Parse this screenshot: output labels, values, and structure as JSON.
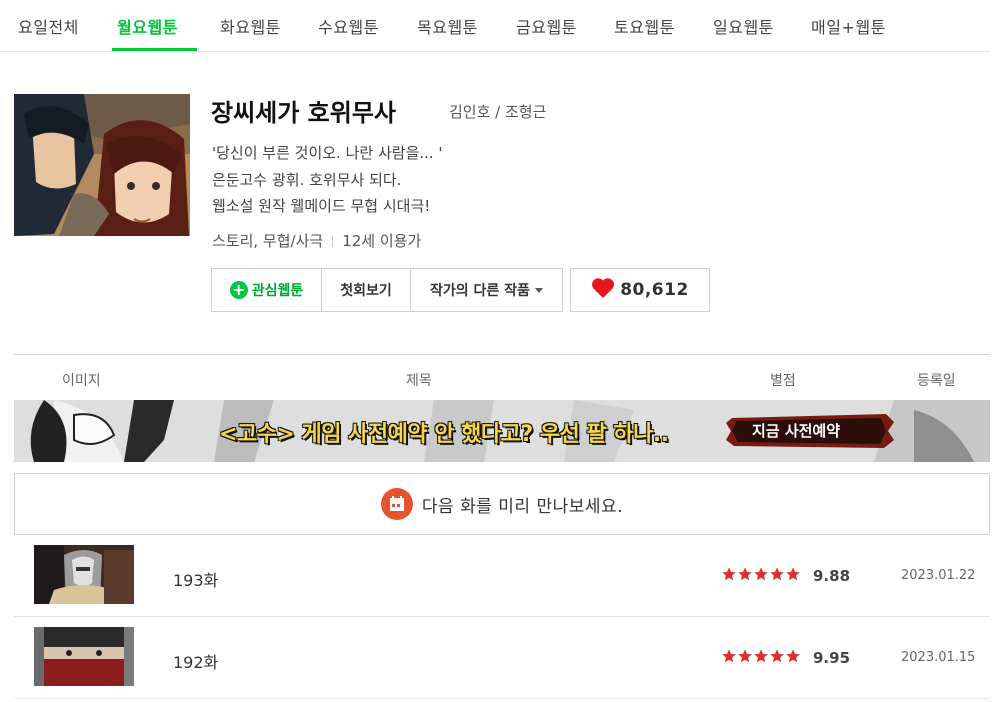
{
  "tabs": [
    {
      "label": "요일전체",
      "active": false
    },
    {
      "label": "월요웹툰",
      "active": true
    },
    {
      "label": "화요웹툰",
      "active": false
    },
    {
      "label": "수요웹툰",
      "active": false
    },
    {
      "label": "목요웹툰",
      "active": false
    },
    {
      "label": "금요웹툰",
      "active": false
    },
    {
      "label": "토요웹툰",
      "active": false
    },
    {
      "label": "일요웹툰",
      "active": false
    },
    {
      "label": "매일+웹툰",
      "active": false
    }
  ],
  "webtoon": {
    "title": "장씨세가 호위무사",
    "author": "김인호 / 조형근",
    "desc1": "'당신이 부른 것이오. 나란 사람을... '",
    "desc2": "은둔고수 광휘. 호위무사 되다.",
    "desc3": "웹소설 원작 웰메이드 무협 시대극!",
    "genre": "스토리, 무협/사극",
    "age": "12세 이용가"
  },
  "buttons": {
    "favorite": "관심웹툰",
    "first_episode": "첫회보기",
    "other_works": "작가의 다른 작품",
    "like_count": "80,612"
  },
  "table_header": {
    "image": "이미지",
    "title": "제목",
    "rating": "별점",
    "date": "등록일"
  },
  "banner": {
    "text": "<고수> 게임 사전예약 안 했다고? 우선 팔 하나..",
    "cta": "지금 사전예약"
  },
  "preview": {
    "text": "다음 화를 미리 만나보세요."
  },
  "episodes": [
    {
      "title": "193화",
      "rating": "9.88",
      "date": "2023.01.22"
    },
    {
      "title": "192화",
      "rating": "9.95",
      "date": "2023.01.15"
    }
  ],
  "colors": {
    "accent": "#00c73c",
    "star": "#e52d2d",
    "heart": "#e5161d",
    "calendar": "#e5532f"
  }
}
